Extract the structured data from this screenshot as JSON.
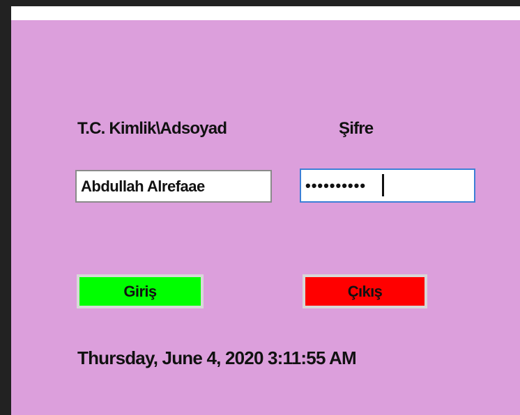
{
  "form": {
    "id_label": "T.C. Kimlik\\Adsoyad",
    "password_label": "Şifre",
    "id_value": "Abdullah Alrefaae",
    "password_value": "••••••••••",
    "login_label": "Giriş",
    "exit_label": "Çıkış",
    "datetime": "Thursday, June 4, 2020  3:11:55 AM"
  },
  "colors": {
    "form_background": "#dc9fdc",
    "login_button": "#00ff00",
    "exit_button": "#ff0000",
    "focus_border": "#3c7fd6"
  }
}
